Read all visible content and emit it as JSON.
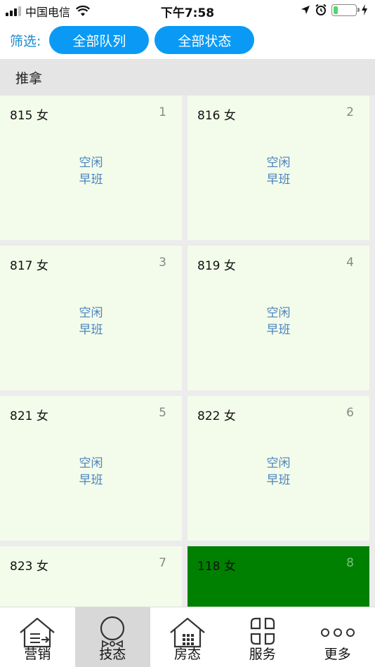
{
  "status_bar": {
    "carrier": "中国电信",
    "time": "下午7:58",
    "battery_level": 0.2
  },
  "filter": {
    "label": "筛选:",
    "queue_button": "全部队列",
    "status_button": "全部状态"
  },
  "section": {
    "title": "推拿"
  },
  "cards": [
    {
      "title": "815 女",
      "index": "1",
      "status": "空闲",
      "shift": "早班",
      "active": false
    },
    {
      "title": "816 女",
      "index": "2",
      "status": "空闲",
      "shift": "早班",
      "active": false
    },
    {
      "title": "817 女",
      "index": "3",
      "status": "空闲",
      "shift": "早班",
      "active": false
    },
    {
      "title": "819 女",
      "index": "4",
      "status": "空闲",
      "shift": "早班",
      "active": false
    },
    {
      "title": "821 女",
      "index": "5",
      "status": "空闲",
      "shift": "早班",
      "active": false
    },
    {
      "title": "822 女",
      "index": "6",
      "status": "空闲",
      "shift": "早班",
      "active": false
    },
    {
      "title": "823 女",
      "index": "7",
      "status": "",
      "shift": "",
      "active": false
    },
    {
      "title": "118 女",
      "index": "8",
      "status": "",
      "shift": "",
      "active": true
    }
  ],
  "tabs": [
    {
      "label": "营销",
      "icon": "marketing-house-icon",
      "selected": false
    },
    {
      "label": "技态",
      "icon": "technician-status-icon",
      "selected": true
    },
    {
      "label": "房态",
      "icon": "room-status-icon",
      "selected": false
    },
    {
      "label": "服务",
      "icon": "service-icon",
      "selected": false
    },
    {
      "label": "更多",
      "icon": "more-dots-icon",
      "selected": false
    }
  ],
  "colors": {
    "accent": "#0a9af5",
    "card_bg": "#f3fcea",
    "card_active": "#008000",
    "status_text": "#4a82c0"
  }
}
